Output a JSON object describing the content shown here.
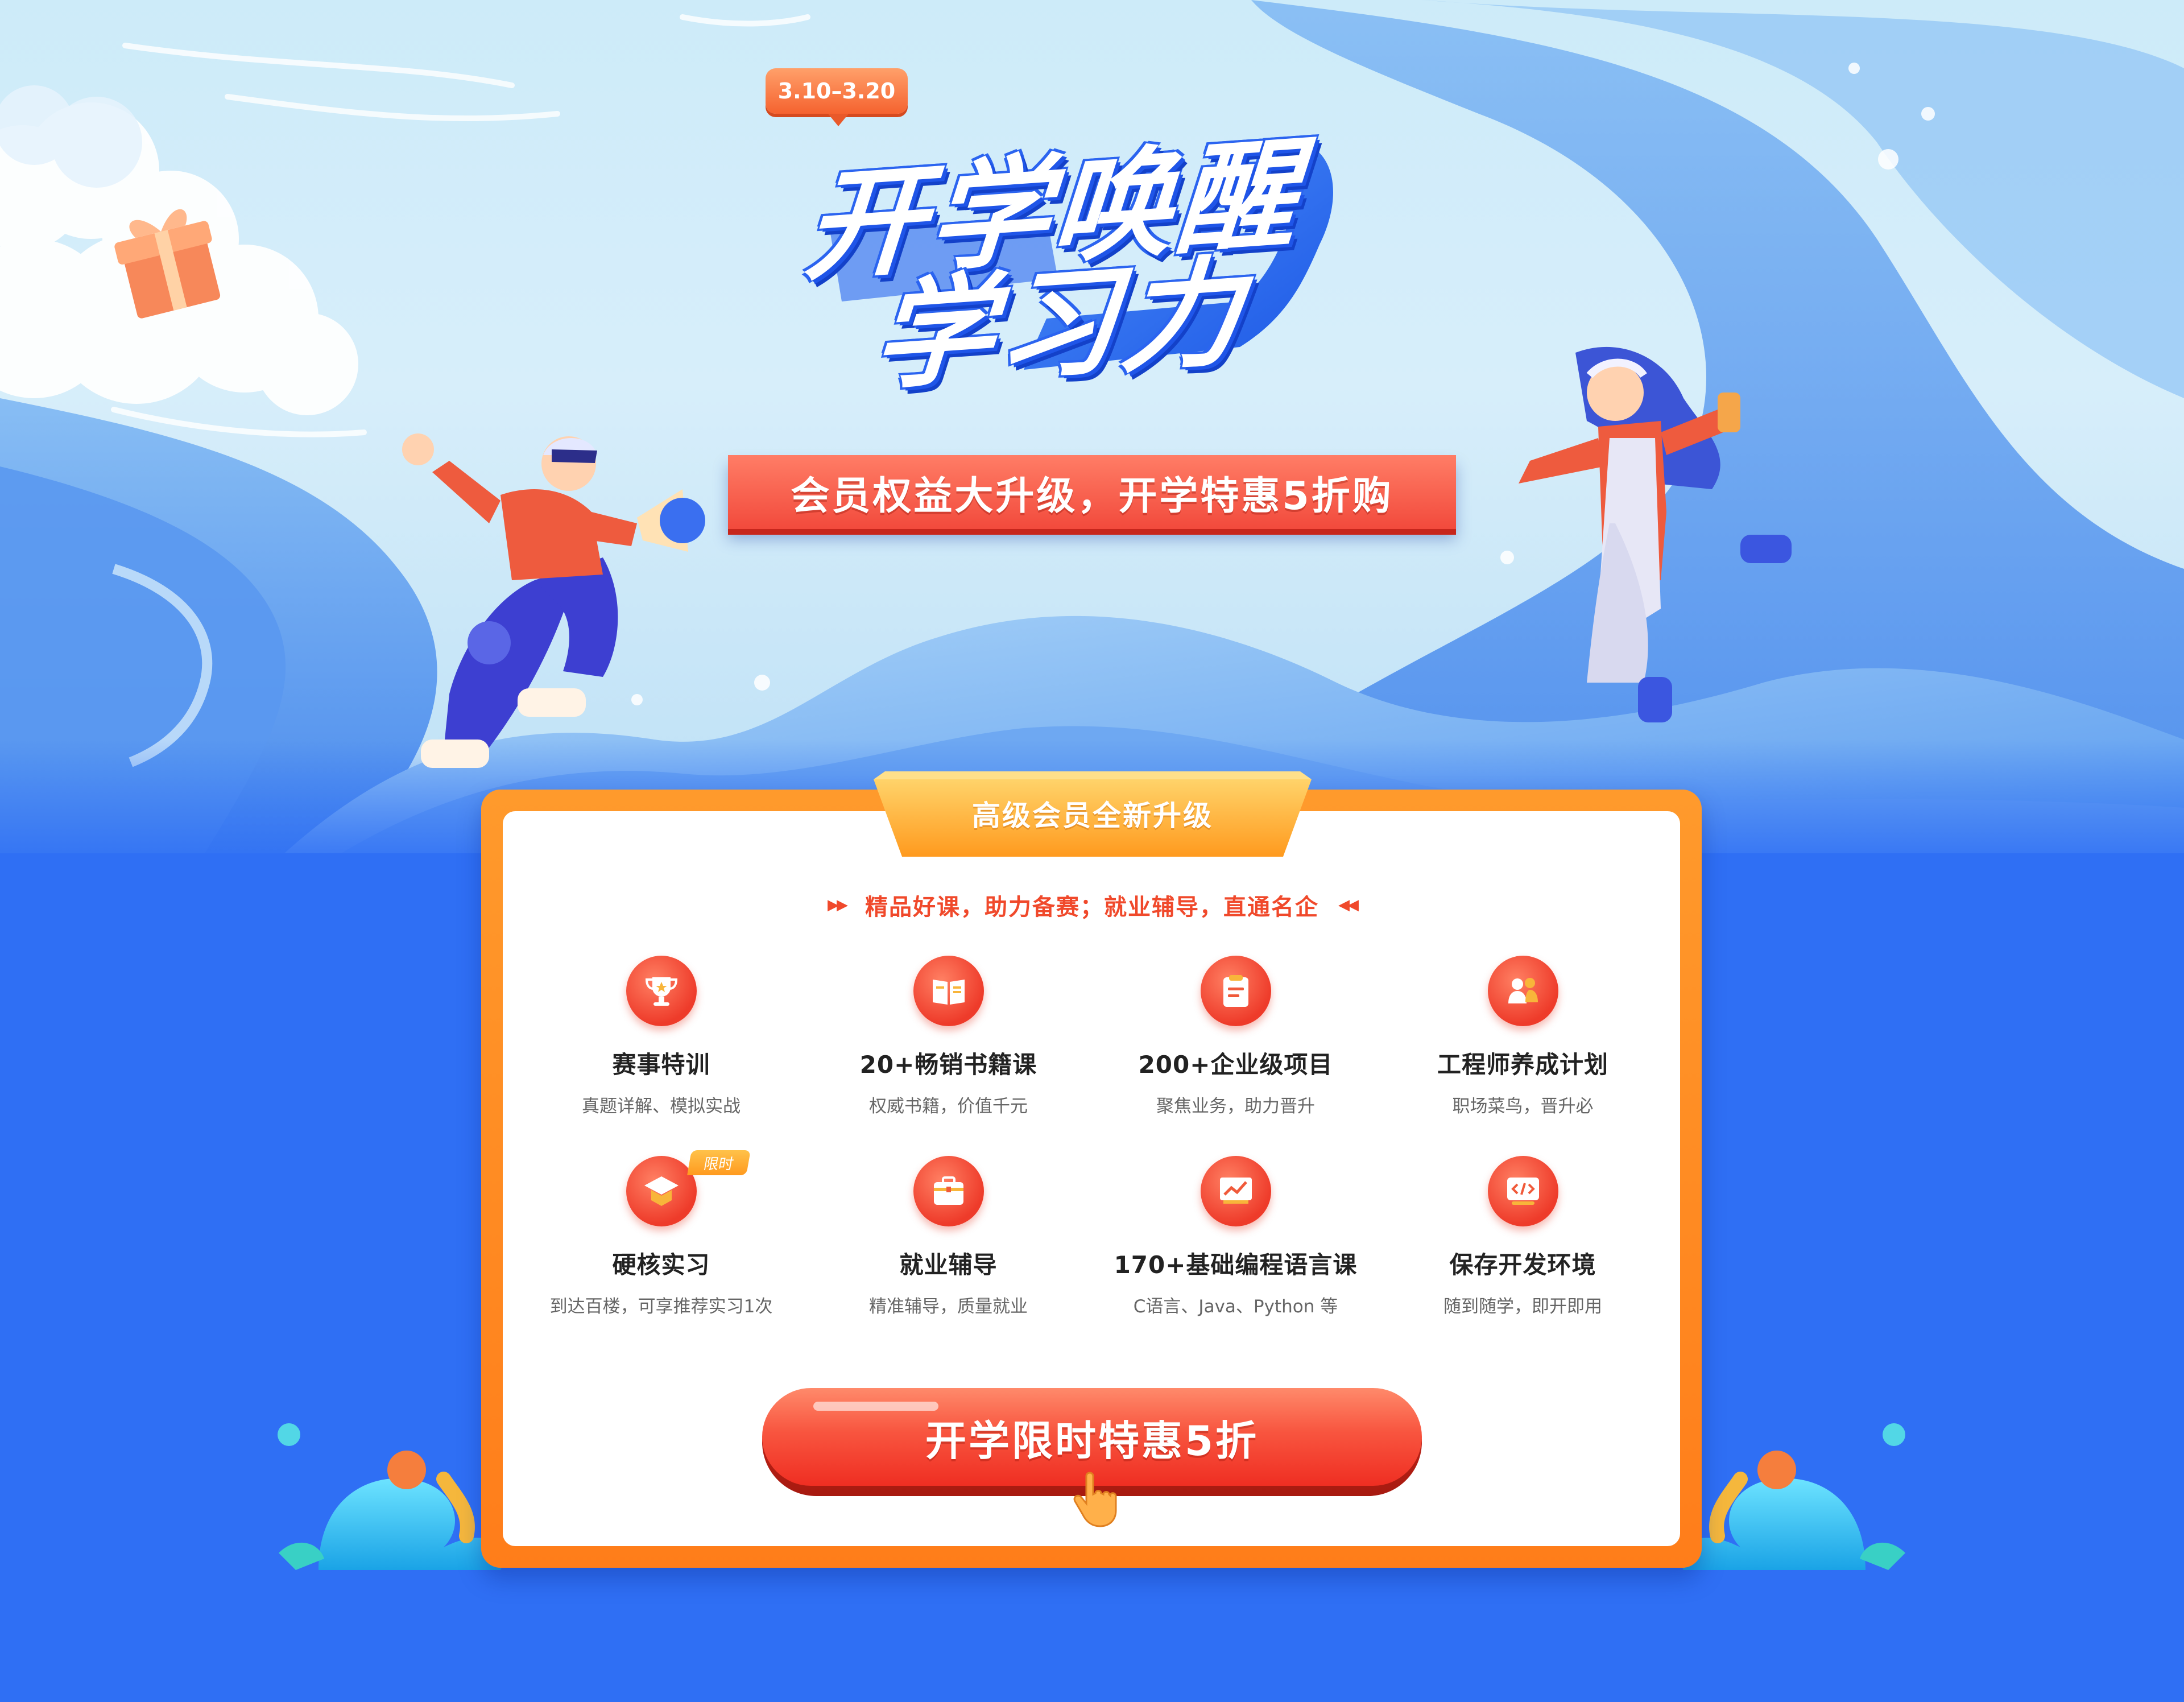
{
  "promo": {
    "date_range": "3.10–3.20",
    "title_line1": "开学唤醒",
    "title_line2": "学习力",
    "slogan": "会员权益大升级，开学特惠5折购"
  },
  "card": {
    "header": "高级会员全新升级",
    "tagline": "精品好课，助力备赛；就业辅导，直通名企",
    "features": [
      {
        "icon": "trophy-icon",
        "title": "赛事特训",
        "desc": "真题详解、模拟实战"
      },
      {
        "icon": "book-icon",
        "title": "20+畅销书籍课",
        "desc": "权威书籍，价值千元"
      },
      {
        "icon": "document-icon",
        "title": "200+企业级项目",
        "desc": "聚焦业务，助力晋升"
      },
      {
        "icon": "people-icon",
        "title": "工程师养成计划",
        "desc": "职场菜鸟，晋升必"
      },
      {
        "icon": "graduation-cap-icon",
        "title": "硬核实习",
        "desc": "到达百楼，可享推荐实习1次",
        "badge": "限时"
      },
      {
        "icon": "briefcase-icon",
        "title": "就业辅导",
        "desc": "精准辅导，质量就业"
      },
      {
        "icon": "chart-board-icon",
        "title": "170+基础编程语言课",
        "desc": "C语言、Java、Python 等"
      },
      {
        "icon": "code-monitor-icon",
        "title": "保存开发环境",
        "desc": "随到随学，即开即用"
      }
    ],
    "cta_label": "开学限时特惠5折"
  },
  "colors": {
    "background_blue": "#2f6ff4",
    "accent_orange": "#ff8a22",
    "accent_red": "#ef3b2a"
  }
}
